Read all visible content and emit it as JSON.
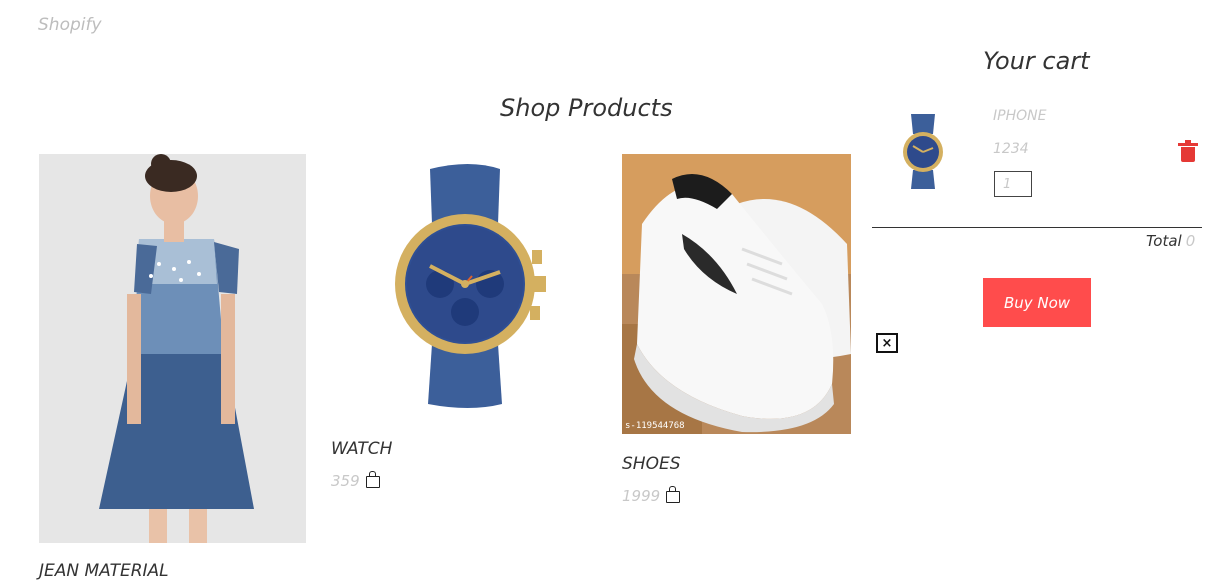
{
  "header": {
    "brand": "Shopify"
  },
  "main": {
    "title": "Shop Products",
    "products": [
      {
        "name": "JEAN MATERIAL",
        "image": "denim-dress-photo"
      },
      {
        "name": "WATCH",
        "price": "359",
        "image": "blue-watch-photo"
      },
      {
        "name": "SHOES",
        "price": "1999",
        "image": "white-sneaker-photo",
        "watermark": "s-119544768"
      }
    ]
  },
  "cart": {
    "title": "Your cart",
    "items": [
      {
        "name": "IPHONE",
        "price": "1234",
        "quantity": "1"
      }
    ],
    "total_label": "Total",
    "total_value": "0",
    "buy_label": "Buy Now"
  },
  "icons": {
    "bag": "shopping-bag-icon",
    "trash": "trash-icon",
    "close": "close-box-icon"
  },
  "colors": {
    "accent": "#ff4c4c",
    "muted_text": "#c8c8c8"
  }
}
